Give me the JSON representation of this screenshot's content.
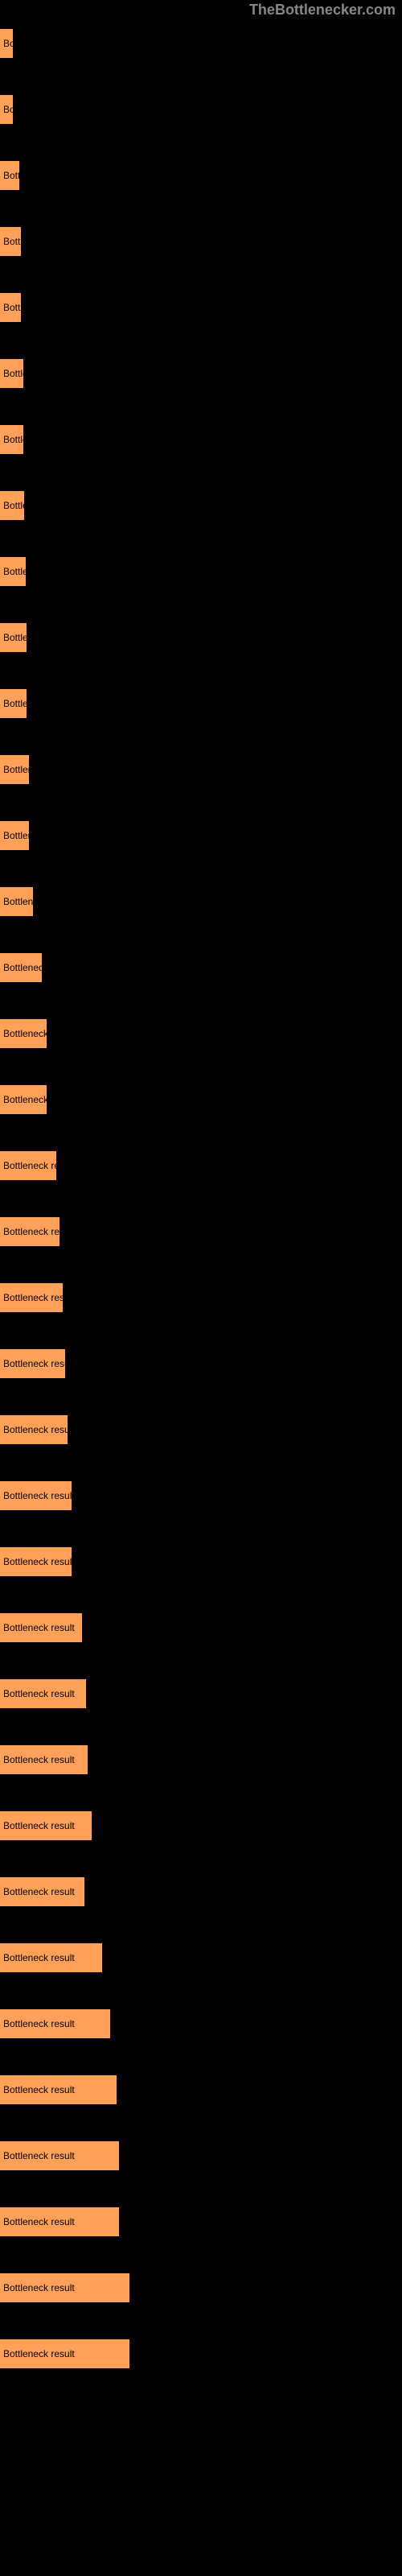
{
  "watermark": "TheBottlenecker.com",
  "chart_data": {
    "type": "bar",
    "title": "",
    "xlabel": "",
    "ylabel": "",
    "bar_color": "#ffa159",
    "label": "Bottleneck result",
    "bars": [
      {
        "width": 16
      },
      {
        "width": 16
      },
      {
        "width": 24
      },
      {
        "width": 26
      },
      {
        "width": 26
      },
      {
        "width": 29
      },
      {
        "width": 29
      },
      {
        "width": 30
      },
      {
        "width": 32
      },
      {
        "width": 33
      },
      {
        "width": 33
      },
      {
        "width": 36
      },
      {
        "width": 36
      },
      {
        "width": 41
      },
      {
        "width": 52
      },
      {
        "width": 58
      },
      {
        "width": 58
      },
      {
        "width": 70
      },
      {
        "width": 74
      },
      {
        "width": 78
      },
      {
        "width": 81
      },
      {
        "width": 84
      },
      {
        "width": 89
      },
      {
        "width": 89
      },
      {
        "width": 102
      },
      {
        "width": 107
      },
      {
        "width": 109
      },
      {
        "width": 114
      },
      {
        "width": 105
      },
      {
        "width": 127
      },
      {
        "width": 137
      },
      {
        "width": 145
      },
      {
        "width": 148
      },
      {
        "width": 148
      },
      {
        "width": 161
      },
      {
        "width": 161
      }
    ]
  }
}
